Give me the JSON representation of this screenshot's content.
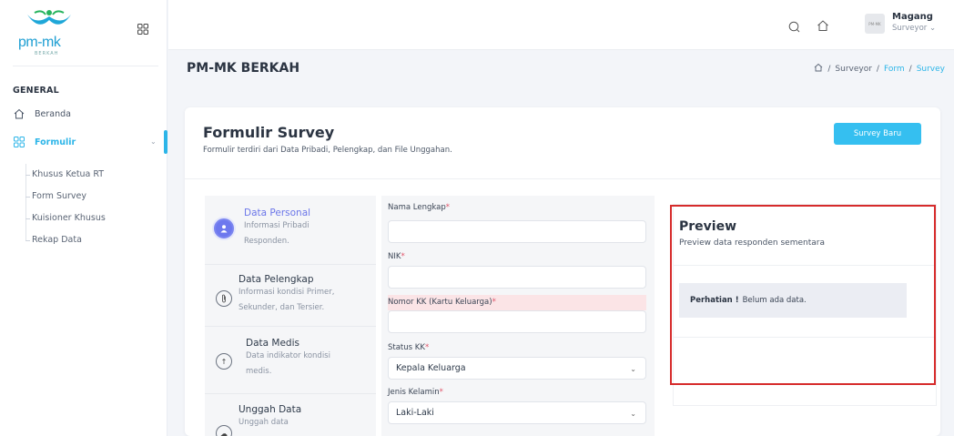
{
  "brand": {
    "name": "pm-mk",
    "sub": "BERKAH"
  },
  "sidebar": {
    "section": "GENERAL",
    "items": [
      {
        "label": "Beranda",
        "icon": "home-icon"
      },
      {
        "label": "Formulir",
        "icon": "grid-icon"
      }
    ],
    "subitems": [
      "Khusus Ketua RT",
      "Form Survey",
      "Kuisioner Khusus",
      "Rekap Data"
    ]
  },
  "topbar": {
    "user": "Magang",
    "role": "Surveyor",
    "avatar_text": "PM-MK"
  },
  "page": {
    "title": "PM-MK BERKAH",
    "breadcrumb": [
      "Surveyor",
      "Form",
      "Survey"
    ]
  },
  "card": {
    "title": "Formulir Survey",
    "subtitle": "Formulir terdiri dari Data Pribadi, Pelengkap, dan File Unggahan.",
    "new_button": "Survey Baru"
  },
  "steps": [
    {
      "title": "Data Personal",
      "desc1": "Informasi Pribadi",
      "desc2": "Responden."
    },
    {
      "title": "Data Pelengkap",
      "desc1": "Informasi kondisi Primer,",
      "desc2": "Sekunder, dan Tersier."
    },
    {
      "title": "Data Medis",
      "desc1": "Data indikator kondisi",
      "desc2": "medis."
    },
    {
      "title": "Unggah Data",
      "desc1": "Unggah data",
      "desc2": ""
    }
  ],
  "form": {
    "nama_label": "Nama Lengkap",
    "nik_label": "NIK",
    "kk_label": "Nomor KK (Kartu Keluarga)",
    "status_label": "Status KK",
    "status_value": "Kepala Keluarga",
    "gender_label": "Jenis Kelamin",
    "gender_value": "Laki-Laki",
    "required_mark": "*"
  },
  "preview": {
    "title": "Preview",
    "subtitle": "Preview data responden sementara",
    "alert_strong": "Perhatian !",
    "alert_text": "Belum ada data."
  },
  "colors": {
    "accent": "#2cb5e8",
    "step_active": "#6d78ee",
    "highlight": "#d62b2b"
  }
}
